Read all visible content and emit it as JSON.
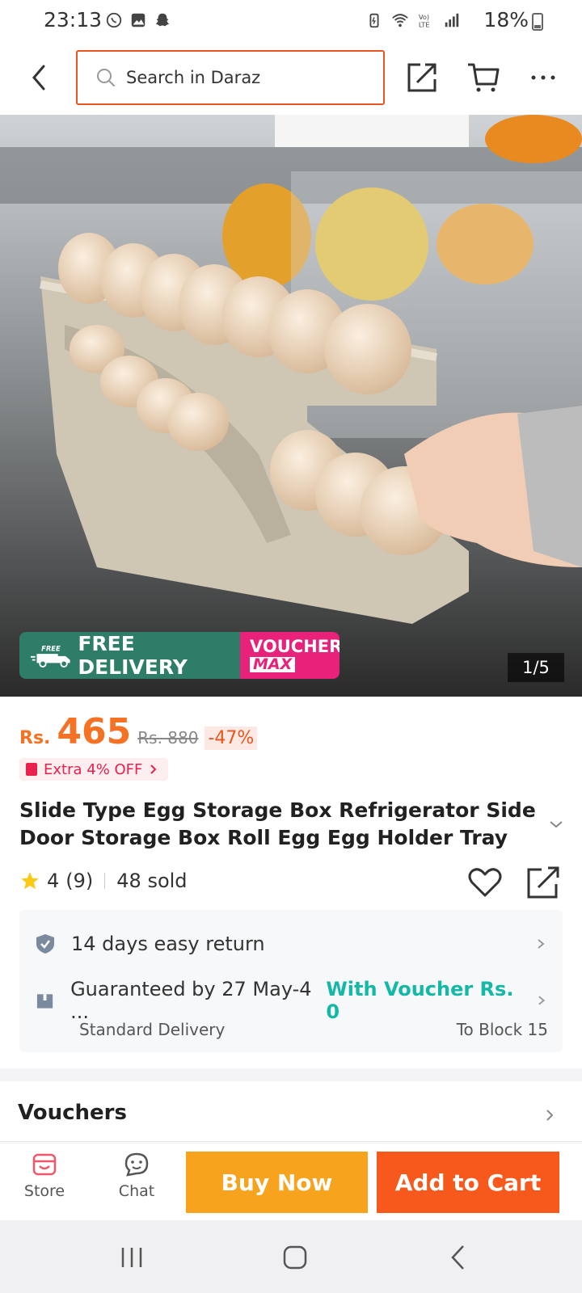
{
  "status_bar": {
    "time": "23:13",
    "battery": "18%",
    "left_icons": [
      "whatsapp-icon",
      "gallery-icon",
      "snapchat-icon"
    ],
    "right_icons": [
      "battery-saver-icon",
      "wifi-icon",
      "volte-icon",
      "signal-icon"
    ]
  },
  "header": {
    "search_placeholder": "Search in Daraz",
    "accent_color": "#e8561f"
  },
  "product_image": {
    "banner_free": "FREE DELIVERY",
    "banner_free_badge": "FREE",
    "banner_voucher_top": "VOUCHER",
    "banner_voucher_bottom": "MAX",
    "counter": "1/5"
  },
  "price": {
    "currency": "Rs.",
    "current": "465",
    "original": "Rs. 880",
    "discount": "-47%",
    "extra_off": "Extra 4% OFF",
    "color": "#f57224"
  },
  "product": {
    "title": "Slide Type Egg Storage Box Refrigerator Side Door Storage Box Roll Egg Egg Holder Tray Aut...",
    "rating": "4",
    "reviews": "(9)",
    "sold": "48 sold"
  },
  "delivery": {
    "returns": "14 days easy return",
    "guarantee": "Guaranteed by 27 May-4 ...",
    "voucher_text": "With Voucher Rs. 0",
    "delivery_type": "Standard Delivery",
    "destination": "To Block 15",
    "voucher_color": "#14b8a6"
  },
  "vouchers": {
    "label": "Vouchers"
  },
  "bottom_bar": {
    "store_label": "Store",
    "chat_label": "Chat",
    "buy_now": "Buy Now",
    "add_to_cart": "Add to Cart",
    "buy_color": "#f7a31e",
    "cart_color": "#f7581c"
  }
}
